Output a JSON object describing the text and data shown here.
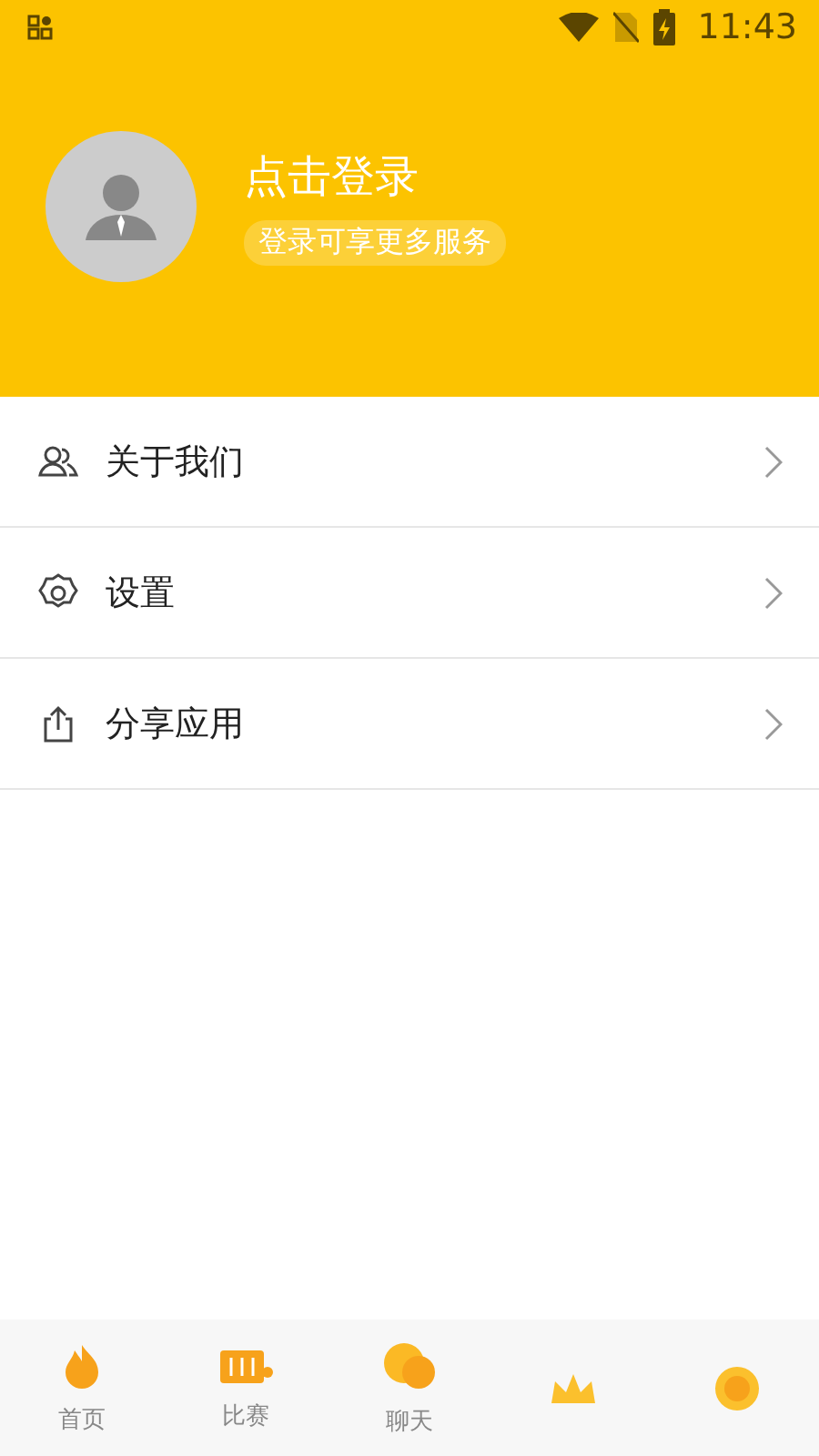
{
  "status_bar": {
    "time": "11:43"
  },
  "profile": {
    "title": "点击登录",
    "subtitle": "登录可享更多服务"
  },
  "menu": [
    {
      "kind": "people",
      "label": "关于我们"
    },
    {
      "kind": "gear",
      "label": "设置"
    },
    {
      "kind": "share",
      "label": "分享应用"
    }
  ],
  "tabs": [
    {
      "kind": "labeled",
      "label": "首页"
    },
    {
      "kind": "labeled",
      "label": "比赛"
    },
    {
      "kind": "labeled",
      "label": "聊天"
    },
    {
      "kind": "icon_only"
    },
    {
      "kind": "icon_only"
    }
  ]
}
